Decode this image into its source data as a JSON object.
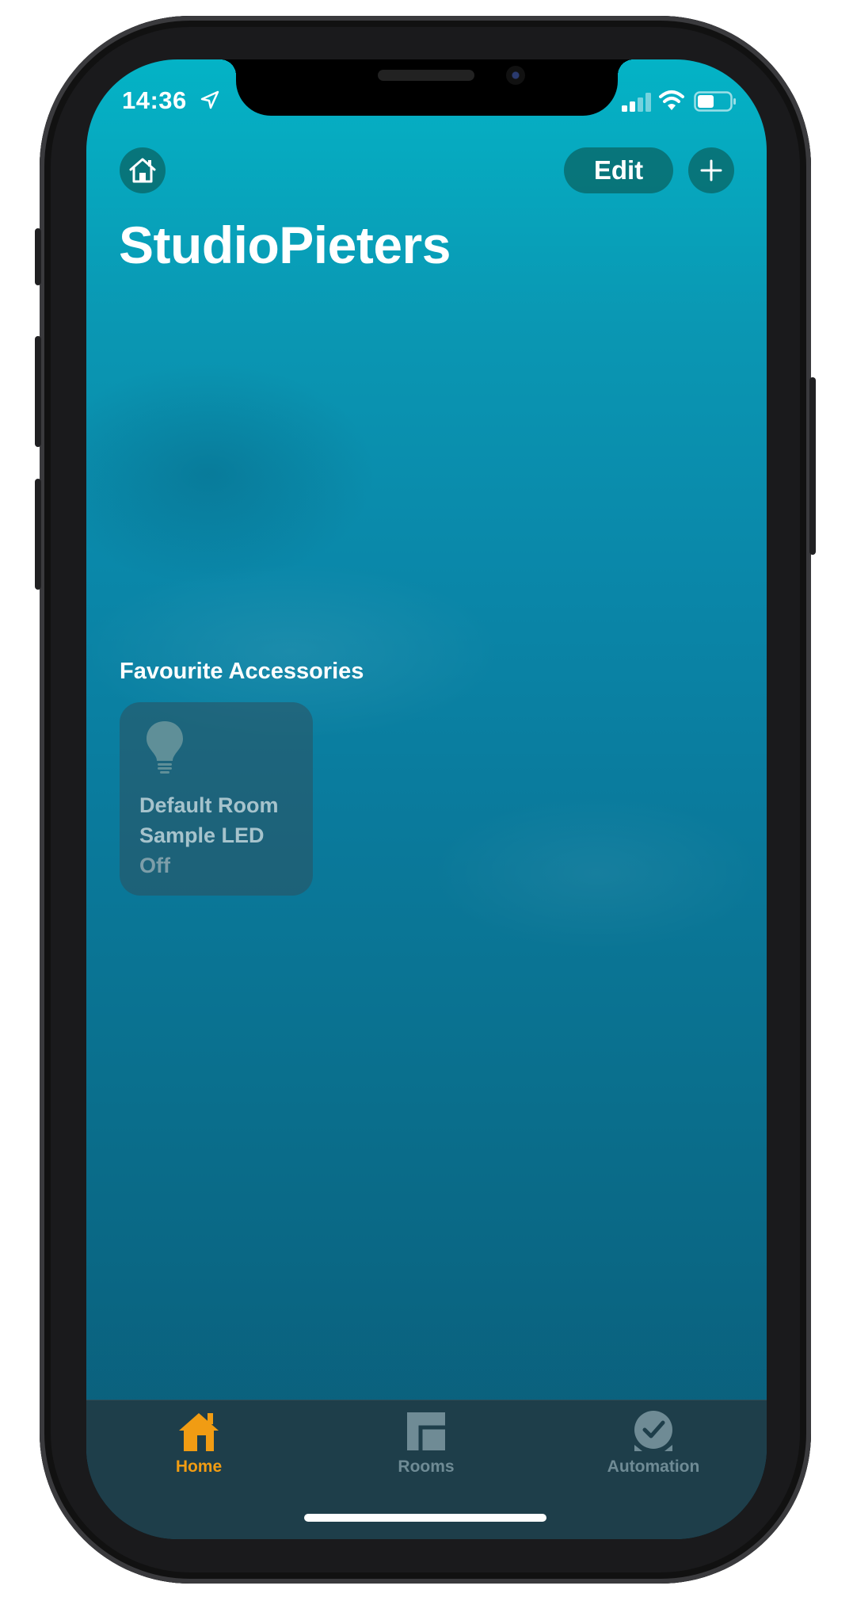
{
  "status_bar": {
    "time": "14:36",
    "location_icon": "location-arrow-icon",
    "signal_icon": "cellular-signal-icon",
    "wifi_icon": "wifi-icon",
    "battery_icon": "battery-icon",
    "battery_level": 0.5
  },
  "header": {
    "home_icon": "house-icon",
    "edit_label": "Edit",
    "add_icon": "plus-icon",
    "title": "StudioPieters"
  },
  "favourites": {
    "section_title": "Favourite Accessories",
    "tiles": [
      {
        "icon": "lightbulb-icon",
        "room": "Default Room",
        "name": "Sample LED",
        "status": "Off"
      }
    ]
  },
  "tab_bar": {
    "active_color": "#F19C13",
    "inactive_color": "#6F8B95",
    "tabs": [
      {
        "label": "Home",
        "icon": "house-fill-icon",
        "active": true
      },
      {
        "label": "Rooms",
        "icon": "rooms-icon",
        "active": false
      },
      {
        "label": "Automation",
        "icon": "clock-check-icon",
        "active": false
      }
    ]
  },
  "colors": {
    "background_top": "#04B3C6",
    "background_bottom": "#0B5B77",
    "button_fill": "#0A6464"
  }
}
